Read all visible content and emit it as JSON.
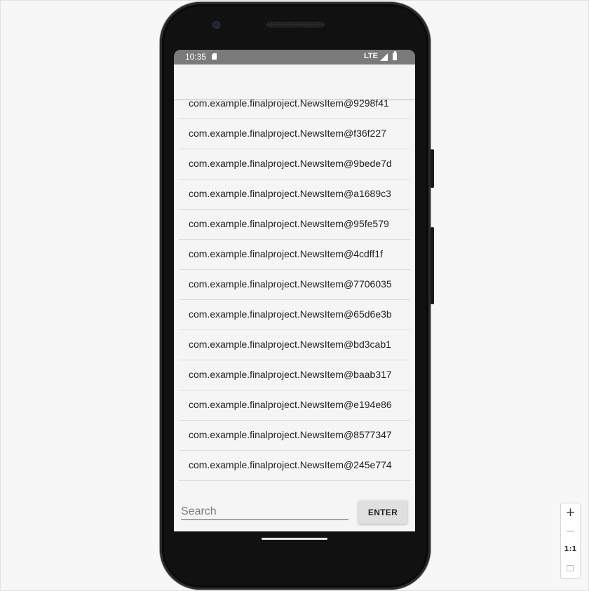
{
  "status_bar": {
    "time": "10:35",
    "network": "LTE",
    "icons": [
      "sd-card-icon",
      "signal-icon",
      "battery-icon"
    ]
  },
  "news_list": {
    "items": [
      "com.example.finalproject.NewsItem@9298f41",
      "com.example.finalproject.NewsItem@f36f227",
      "com.example.finalproject.NewsItem@9bede7d",
      "com.example.finalproject.NewsItem@a1689c3",
      "com.example.finalproject.NewsItem@95fe579",
      "com.example.finalproject.NewsItem@4cdff1f",
      "com.example.finalproject.NewsItem@7706035",
      "com.example.finalproject.NewsItem@65d6e3b",
      "com.example.finalproject.NewsItem@bd3cab1",
      "com.example.finalproject.NewsItem@baab317",
      "com.example.finalproject.NewsItem@e194e86",
      "com.example.finalproject.NewsItem@8577347",
      "com.example.finalproject.NewsItem@245e774"
    ]
  },
  "search": {
    "placeholder": "Search",
    "value": ""
  },
  "enter_button": {
    "label": "ENTER"
  },
  "zoom_controls": {
    "zoom_in": "+",
    "zoom_out": "−",
    "reset": "1:1",
    "fit_icon": "fit-screen-icon"
  },
  "colors": {
    "status_bar": "#7a7a7a",
    "app_bar": "#f5f5f5",
    "button": "#e0e0e0",
    "frame": "#111111"
  }
}
